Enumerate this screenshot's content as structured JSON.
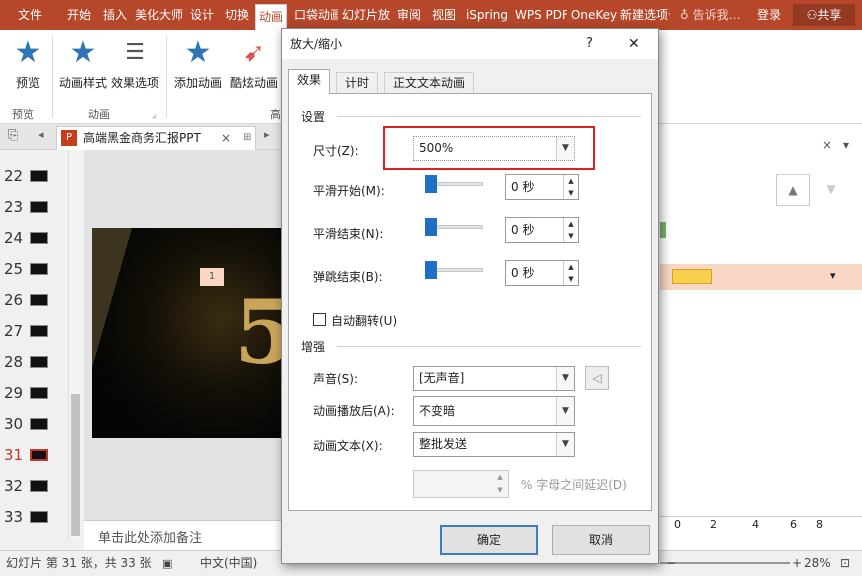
{
  "ribbon_tabs": {
    "file": "文件",
    "home": "开始",
    "insert": "插入",
    "beautify": "美化大师",
    "design": "设计",
    "transition": "切换",
    "animation": "动画",
    "pocket": "口袋动画",
    "slideshow": "幻灯片放映",
    "review": "审阅",
    "view": "视图",
    "ispring": "iSpring",
    "wps": "WPS PDF",
    "onekey": "OneKey",
    "newtab": "新建选项卡",
    "tell": "告诉我…",
    "login": "登录",
    "share": "共享"
  },
  "ribbon": {
    "preview": "预览",
    "anim_style": "动画样式",
    "effect_opts": "效果选项",
    "add_anim": "添加动画",
    "cool_anim": "酷炫动画",
    "group_preview": "预览",
    "group_anim": "动画",
    "group_adv": "高"
  },
  "doc": {
    "name": "高端黑金商务汇报PPT",
    "close": "×"
  },
  "slides": [
    {
      "n": "22"
    },
    {
      "n": "23"
    },
    {
      "n": "24"
    },
    {
      "n": "25"
    },
    {
      "n": "26"
    },
    {
      "n": "27"
    },
    {
      "n": "28"
    },
    {
      "n": "29"
    },
    {
      "n": "30"
    },
    {
      "n": "31"
    },
    {
      "n": "32"
    },
    {
      "n": "33"
    }
  ],
  "slide": {
    "big_text": "5",
    "badge": "1"
  },
  "notes": {
    "placeholder": "单击此处添加备注"
  },
  "status": {
    "slide_info": "幻灯片 第 31 张，共 33 张",
    "language": "中文(中国)",
    "zoom": "28%",
    "ruler": [
      "0",
      "2",
      "4",
      "6",
      "8"
    ]
  },
  "dialog": {
    "title": "放大/缩小",
    "help": "?",
    "close": "✕",
    "tabs": {
      "effect": "效果",
      "timing": "计时",
      "text_anim": "正文文本动画"
    },
    "settings": {
      "heading": "设置",
      "size_label": "尺寸(Z):",
      "size_value": "500%",
      "smooth_start_label": "平滑开始(M):",
      "smooth_start_value": "0 秒",
      "smooth_end_label": "平滑结束(N):",
      "smooth_end_value": "0 秒",
      "bounce_end_label": "弹跳结束(B):",
      "bounce_end_value": "0 秒",
      "auto_reverse": "自动翻转(U)"
    },
    "enhance": {
      "heading": "增强",
      "sound_label": "声音(S):",
      "sound_value": "[无声音]",
      "after_label": "动画播放后(A):",
      "after_value": "不变暗",
      "text_label": "动画文本(X):",
      "text_value": "整批发送",
      "delay_text": "% 字母之间延迟(D)",
      "delay_value": ""
    },
    "ok": "确定",
    "cancel": "取消"
  },
  "colors": {
    "accent": "#b7472a",
    "highlight_box": "#e02020",
    "anim_bar": "#f8d7c4",
    "gold": "#c9a55a"
  }
}
